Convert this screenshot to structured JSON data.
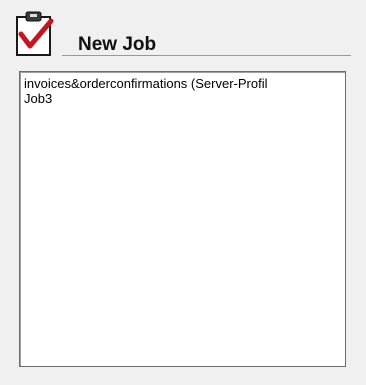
{
  "header": {
    "icon": "clipboard-checkmark-icon",
    "title": "New Job"
  },
  "job_list": {
    "items": [
      "invoices&orderconfirmations (Server-Profil",
      "Job3"
    ]
  },
  "colors": {
    "background": "#f0f0f0",
    "list_background": "#ffffff",
    "checkmark": "#c4161c",
    "border": "#6d6d6d"
  }
}
